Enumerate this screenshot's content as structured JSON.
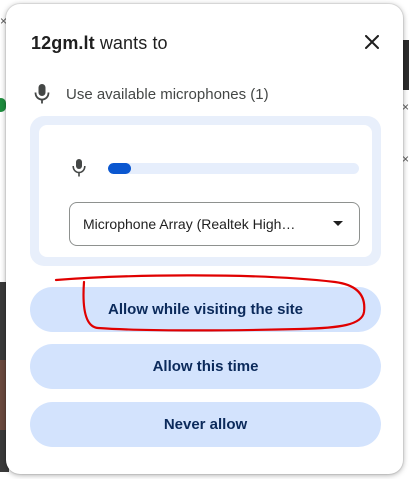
{
  "dialog": {
    "origin": "12gm.lt",
    "title_suffix": "wants to",
    "permission_label": "Use available microphones (1)",
    "device_select": {
      "selected": "Microphone Array (Realtek High…"
    },
    "mic_level": 0.09,
    "buttons": {
      "allow_while_visiting": "Allow while visiting the site",
      "allow_this_time": "Allow this time",
      "never_allow": "Never allow"
    }
  },
  "colors": {
    "accent": "#0b57d0",
    "button_bg": "#d3e3fd",
    "panel_bg": "#e8effb",
    "annotation": "#e00000"
  },
  "icons": [
    "microphone-icon",
    "close-icon",
    "dropdown-caret-icon"
  ]
}
